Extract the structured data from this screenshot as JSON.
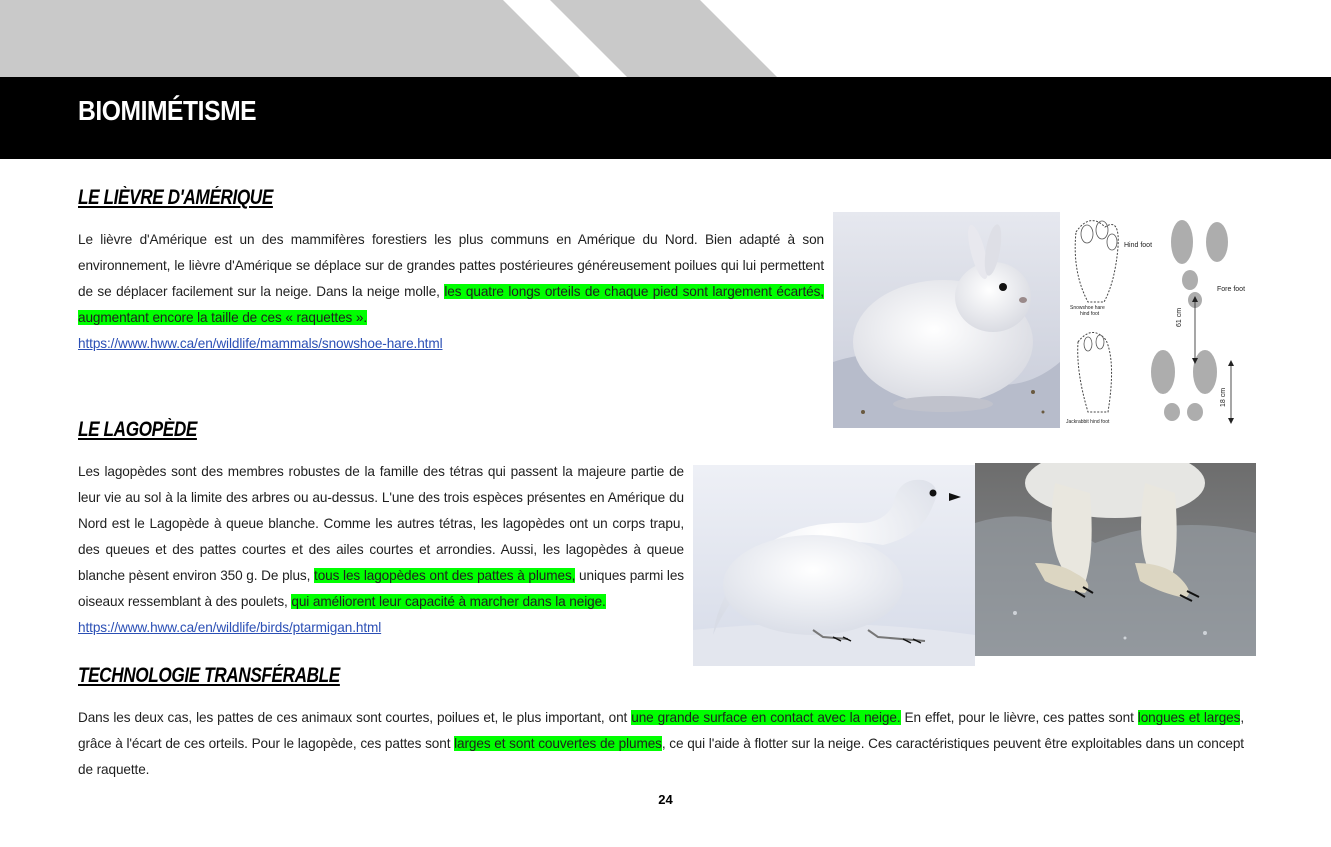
{
  "header": {
    "title": "BIOMIMÉTISME"
  },
  "sections": {
    "lievre": {
      "title": "LE LIÈVRE D'AMÉRIQUE",
      "text_before": "Le lièvre d'Amérique est un des mammifères forestiers les plus communs en Amérique du Nord. Bien adapté à son environnement, le lièvre d'Amérique se déplace sur de grandes pattes postérieures généreusement poilues qui lui permettent de se déplacer facilement sur la neige. Dans la neige molle, ",
      "highlight": "les quatre longs orteils de chaque pied sont largement écartés, augmentant encore la taille de ces « raquettes ».",
      "link": "https://www.hww.ca/en/wildlife/mammals/snowshoe-hare.html"
    },
    "lagopede": {
      "title": "LE LAGOPÈDE",
      "text_before": "Les lagopèdes sont des membres robustes de la famille des tétras qui passent la majeure partie de leur vie au sol à la limite des arbres ou au-dessus. L'une des trois espèces présentes en Amérique du Nord est le Lagopède à queue blanche. Comme les autres tétras, les lagopèdes ont un corps trapu, des queues et des pattes courtes et des ailes courtes et arrondies. Aussi, les lagopèdes à queue blanche pèsent environ 350 g. De plus, ",
      "highlight1": "tous les lagopèdes ont des pattes à plumes,",
      "text_middle": " uniques parmi les oiseaux ressemblant à des poulets, ",
      "highlight2": "qui améliorent leur capacité à marcher dans la neige.",
      "link": "https://www.hww.ca/en/wildlife/birds/ptarmigan.html"
    },
    "technologie": {
      "title": "TECHNOLOGIE TRANSFÉRABLE",
      "t1": "Dans les deux cas, les pattes de ces animaux sont courtes, poilues et, le plus important, ont ",
      "h1": "une grande surface en contact avec la neige.",
      "t2": " En effet, pour le lièvre, ces pattes sont ",
      "h2": "longues et larges",
      "t3": ", grâce à l'écart de ces orteils. Pour le lagopède, ces pattes sont ",
      "h3": "larges et sont couvertes de plumes",
      "t4": ", ce qui l'aide à flotter sur la neige. Ces caractéristiques peuvent être exploitables dans un concept de raquette."
    }
  },
  "diagram_labels": {
    "hind_foot": "Hind foot",
    "fore_foot": "Fore foot",
    "snowshoe_label_1": "Snowshoe hare",
    "snowshoe_label_2": "hind foot",
    "jackrabbit_label": "Jackrabbit hind foot",
    "measure_61": "61 cm",
    "measure_18": "18 cm"
  },
  "page_number": "24",
  "colors": {
    "highlight": "#00ff00",
    "title_bar": "#000000",
    "link": "#2b4fb5"
  }
}
